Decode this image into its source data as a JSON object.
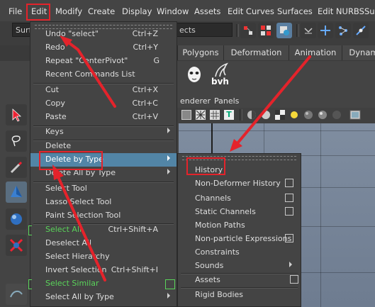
{
  "menubar": {
    "items": [
      "File",
      "Edit",
      "Modify",
      "Create",
      "Display",
      "Window",
      "Assets",
      "Edit Curves",
      "Surfaces",
      "Edit NURBS",
      "Sub"
    ]
  },
  "statusline": {
    "mode_field": "Surf",
    "select_field": "ects"
  },
  "shelf": {
    "tabs": [
      "Polygons",
      "Deformation",
      "Animation",
      "Dynam"
    ],
    "bvh_label": "bvh"
  },
  "panel": {
    "menus": [
      "enderer",
      "Panels"
    ]
  },
  "edit_menu": {
    "items": [
      {
        "label": "Undo \"select\"",
        "shortcut": "Ctrl+Z"
      },
      {
        "label": "Redo",
        "shortcut": "Ctrl+Y"
      },
      {
        "label": "Repeat \"CenterPivot\"",
        "shortcut": "G"
      },
      {
        "label": "Recent Commands List",
        "shortcut": ""
      },
      {
        "label": "Cut",
        "shortcut": "Ctrl+X"
      },
      {
        "label": "Copy",
        "shortcut": "Ctrl+C"
      },
      {
        "label": "Paste",
        "shortcut": "Ctrl+V"
      },
      {
        "label": "Keys",
        "shortcut": ""
      },
      {
        "label": "Delete",
        "shortcut": ""
      },
      {
        "label": "Delete by Type",
        "shortcut": ""
      },
      {
        "label": "Delete All by Type",
        "shortcut": ""
      },
      {
        "label": "Select Tool",
        "shortcut": ""
      },
      {
        "label": "Lasso Select Tool",
        "shortcut": ""
      },
      {
        "label": "Paint Selection Tool",
        "shortcut": ""
      },
      {
        "label": "Select All",
        "shortcut": "Ctrl+Shift+A"
      },
      {
        "label": "Deselect All",
        "shortcut": ""
      },
      {
        "label": "Select Hierarchy",
        "shortcut": ""
      },
      {
        "label": "Invert Selection",
        "shortcut": "Ctrl+Shift+I"
      },
      {
        "label": "Select Similar",
        "shortcut": ""
      },
      {
        "label": "Select All by Type",
        "shortcut": ""
      }
    ]
  },
  "submenu": {
    "items": [
      "History",
      "Non-Deformer History",
      "Channels",
      "Static Channels",
      "Motion Paths",
      "Non-particle Expressions",
      "Constraints",
      "Sounds",
      "Assets",
      "Rigid Bodies"
    ]
  },
  "colors": {
    "highlight": "#5285a6",
    "annotation_red": "#e4232b",
    "option_green": "#5ad45a"
  }
}
